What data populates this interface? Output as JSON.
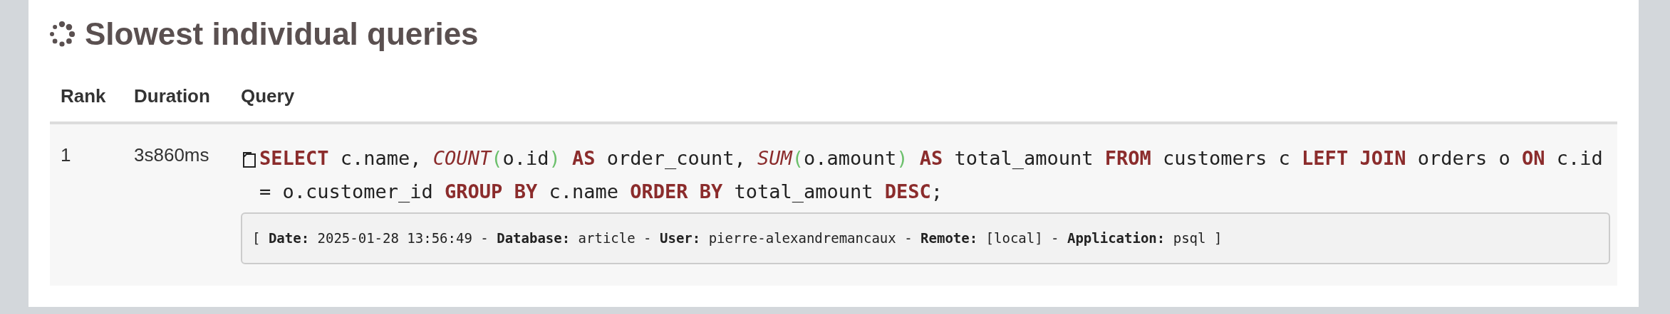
{
  "title": "Slowest individual queries",
  "table": {
    "columns": [
      "Rank",
      "Duration",
      "Query"
    ],
    "rows": [
      {
        "rank": "1",
        "duration": "3s860ms",
        "query": [
          {
            "kind": "keyword",
            "text": "SELECT"
          },
          {
            "kind": "plain",
            "text": " c.name, "
          },
          {
            "kind": "function",
            "text": "COUNT"
          },
          {
            "kind": "paren",
            "text": "("
          },
          {
            "kind": "plain",
            "text": "o.id"
          },
          {
            "kind": "paren",
            "text": ") "
          },
          {
            "kind": "keyword",
            "text": "AS"
          },
          {
            "kind": "plain",
            "text": " order_count, "
          },
          {
            "kind": "function",
            "text": "SUM"
          },
          {
            "kind": "paren",
            "text": "("
          },
          {
            "kind": "plain",
            "text": "o.amount"
          },
          {
            "kind": "paren",
            "text": ") "
          },
          {
            "kind": "keyword",
            "text": "AS"
          },
          {
            "kind": "plain",
            "text": " total_amount "
          },
          {
            "kind": "keyword",
            "text": "FROM"
          },
          {
            "kind": "plain",
            "text": " customers c "
          },
          {
            "kind": "keyword",
            "text": "LEFT JOIN"
          },
          {
            "kind": "plain",
            "text": " orders o "
          },
          {
            "kind": "keyword",
            "text": "ON"
          },
          {
            "kind": "plain",
            "text": " c.id = o.customer_id "
          },
          {
            "kind": "keyword",
            "text": "GROUP BY"
          },
          {
            "kind": "plain",
            "text": " c.name "
          },
          {
            "kind": "keyword",
            "text": "ORDER BY"
          },
          {
            "kind": "plain",
            "text": " total_amount "
          },
          {
            "kind": "keyword",
            "text": "DESC"
          },
          {
            "kind": "plain",
            "text": ";"
          }
        ],
        "details": "[ **Date:** 2025-01-28 13:56:49 - **Database:** article - **User:** pierre-alexandremancaux - **Remote:** [local] - **Application:** psql ]"
      }
    ]
  }
}
